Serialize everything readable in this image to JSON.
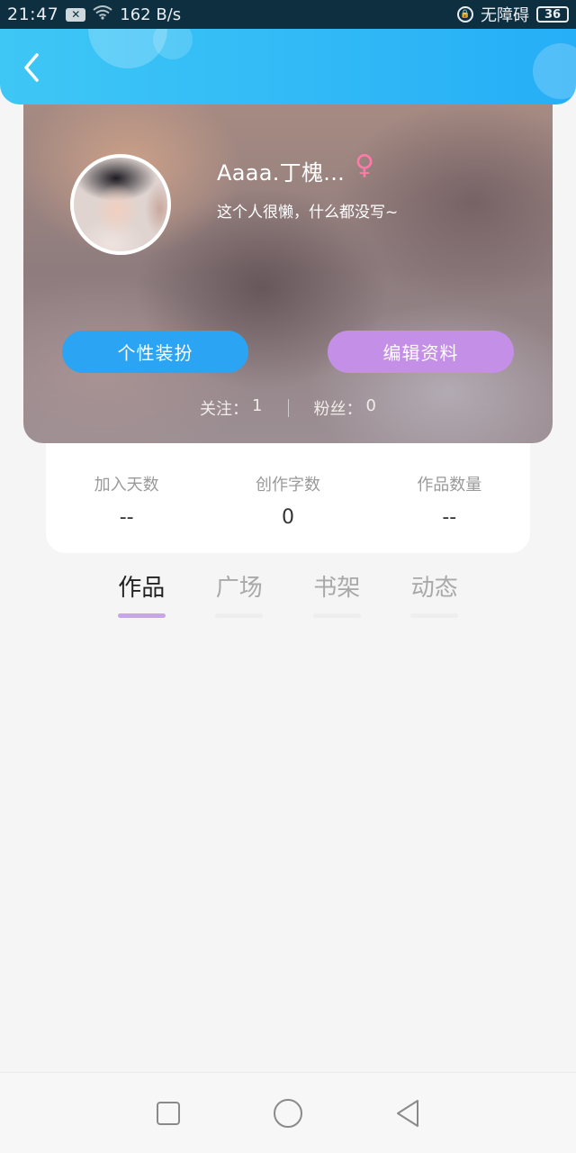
{
  "status_bar": {
    "time": "21:47",
    "mail_icon": "x-mail-icon",
    "network_speed": "162 B/s",
    "accessibility_label": "无障碍",
    "battery": "36"
  },
  "header": {
    "back_icon": "chevron-left-icon",
    "color_start": "#3ec7f5",
    "color_end": "#26aef7"
  },
  "profile": {
    "name": "Aaaa.丁槐...",
    "gender_symbol": "♀",
    "bio": "这个人很懒，什么都没写~",
    "dress_up_button": "个性装扮",
    "edit_profile_button": "编辑资料",
    "following": {
      "label": "关注：",
      "value": "1"
    },
    "followers": {
      "label": "粉丝：",
      "value": "0"
    }
  },
  "stats": [
    {
      "label": "加入天数",
      "value": "--"
    },
    {
      "label": "创作字数",
      "value": "0"
    },
    {
      "label": "作品数量",
      "value": "--"
    }
  ],
  "tabs": [
    {
      "label": "作品",
      "active": true
    },
    {
      "label": "广场",
      "active": false
    },
    {
      "label": "书架",
      "active": false
    },
    {
      "label": "动态",
      "active": false
    }
  ],
  "colors": {
    "dress_button": "#2ba4f4",
    "edit_button": "#c48fe6",
    "active_tab_underline": "#c6a6e6",
    "gender_icon": "#ff7aa8"
  },
  "nav_bar": [
    "square-recents-icon",
    "circle-home-icon",
    "triangle-back-icon"
  ]
}
